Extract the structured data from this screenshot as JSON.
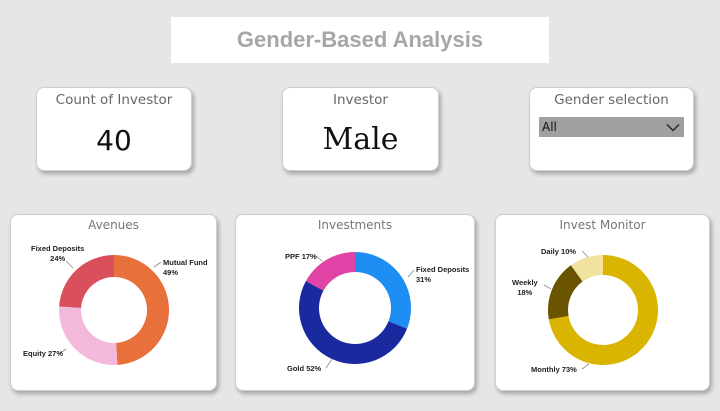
{
  "header": {
    "title": "Gender-Based Analysis"
  },
  "kpis": {
    "count": {
      "title": "Count of Investor",
      "value": "40"
    },
    "investor": {
      "title": "Investor",
      "value": "Male"
    },
    "gender": {
      "title": "Gender selection",
      "selected": "All"
    }
  },
  "chart_data": [
    {
      "type": "pie",
      "title": "Avenues",
      "donut": true,
      "slices": [
        {
          "name": "Mutual Fund",
          "value": 49,
          "label": "49%",
          "color": "#e8703a"
        },
        {
          "name": "Equity",
          "value": 27,
          "label": "27%",
          "color": "#f4b8dc"
        },
        {
          "name": "Fixed Deposits",
          "value": 24,
          "label": "24%",
          "color": "#d94f5c"
        }
      ]
    },
    {
      "type": "pie",
      "title": "Investments",
      "donut": true,
      "slices": [
        {
          "name": "Fixed Deposits",
          "value": 31,
          "label": "31%",
          "color": "#1e8ff2"
        },
        {
          "name": "Gold",
          "value": 52,
          "label": "52%",
          "color": "#1a2a9e"
        },
        {
          "name": "PPF",
          "value": 17,
          "label": "17%",
          "color": "#e044a6"
        }
      ]
    },
    {
      "type": "pie",
      "title": "Invest Monitor",
      "donut": true,
      "slices": [
        {
          "name": "Monthly",
          "value": 73,
          "label": "73%",
          "color": "#d9b400"
        },
        {
          "name": "Weekly",
          "value": 18,
          "label": "18%",
          "color": "#6b5400"
        },
        {
          "name": "Daily",
          "value": 10,
          "label": "10%",
          "color": "#f1e2a0"
        }
      ]
    }
  ]
}
